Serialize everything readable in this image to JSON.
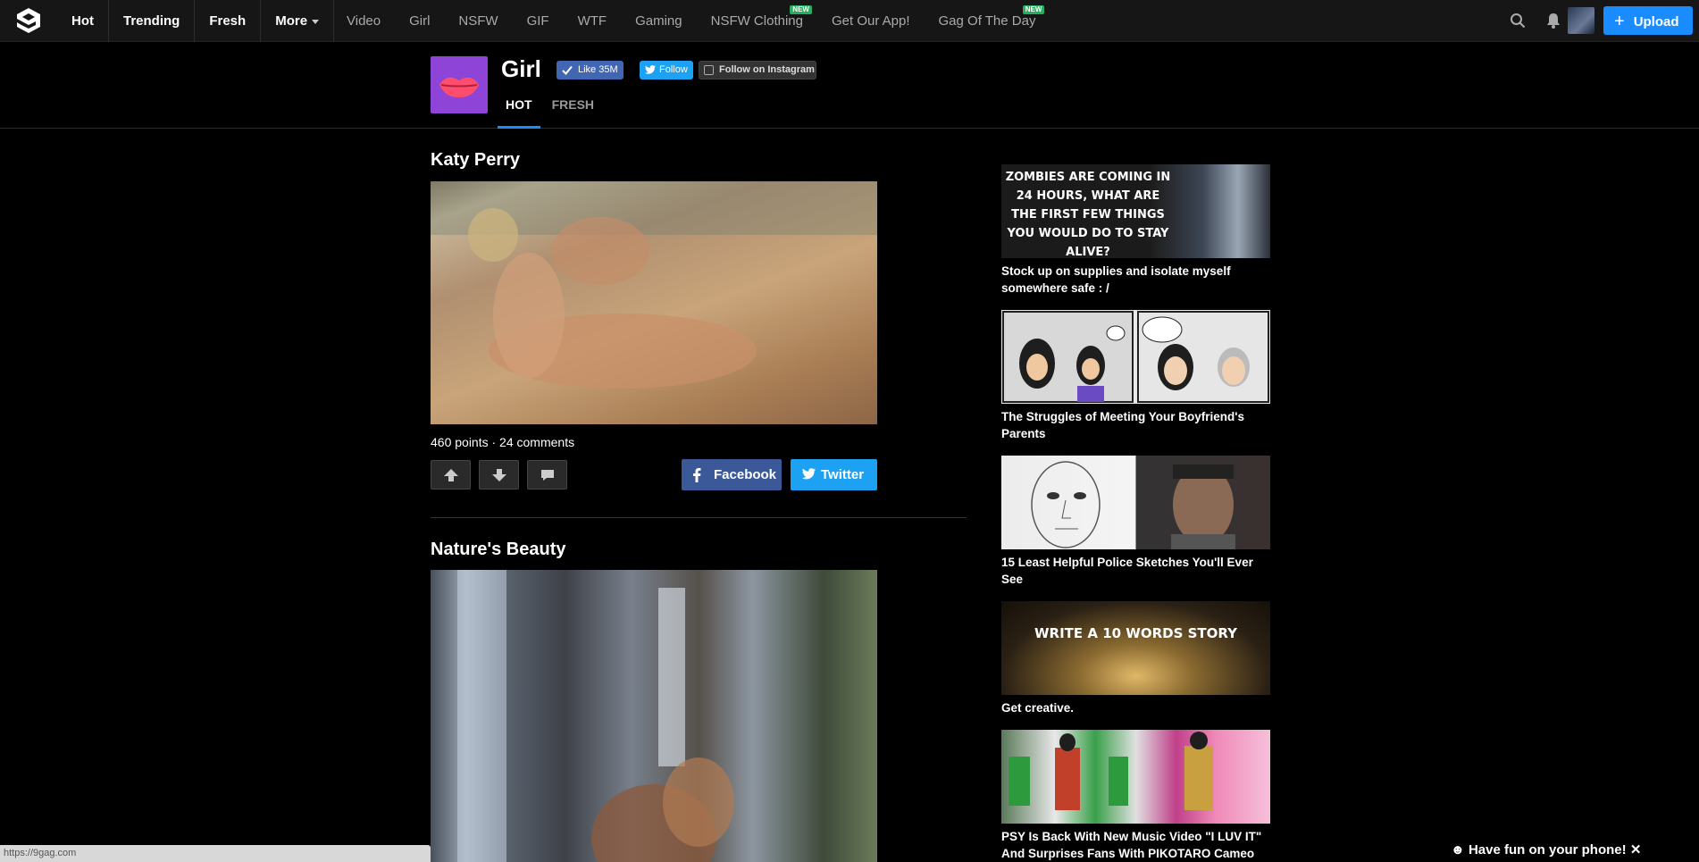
{
  "nav": {
    "main": [
      "Hot",
      "Trending",
      "Fresh",
      "More"
    ],
    "sections": [
      {
        "label": "Video",
        "new": false
      },
      {
        "label": "Girl",
        "new": false
      },
      {
        "label": "NSFW",
        "new": false
      },
      {
        "label": "GIF",
        "new": false
      },
      {
        "label": "WTF",
        "new": false
      },
      {
        "label": "Gaming",
        "new": false
      },
      {
        "label": "NSFW Clothing",
        "new": true
      },
      {
        "label": "Get Our App!",
        "new": false
      },
      {
        "label": "Gag Of The Day",
        "new": true
      }
    ],
    "new_badge": "NEW",
    "upload_label": "Upload"
  },
  "section": {
    "title": "Girl",
    "like_label": "Like 35M",
    "follow_label": "Follow",
    "instagram_label": "Follow on Instagram",
    "tabs": [
      "HOT",
      "FRESH"
    ],
    "icon_color": "#8e44d6"
  },
  "posts": [
    {
      "title": "Katy Perry",
      "meta": "460 points · 24 comments",
      "share_facebook": "Facebook",
      "share_twitter": "Twitter"
    },
    {
      "title": "Nature's Beauty"
    }
  ],
  "sidebar": [
    {
      "thumb_text": "ZOMBIES ARE COMING IN 24 HOURS, WHAT ARE THE FIRST FEW THINGS YOU WOULD DO TO STAY ALIVE?",
      "caption": "Stock up on supplies and isolate myself somewhere safe : /"
    },
    {
      "thumb_text": "",
      "caption": "The Struggles of Meeting Your Boyfriend's Parents"
    },
    {
      "thumb_text": "",
      "caption": "15 Least Helpful Police Sketches You'll Ever See"
    },
    {
      "thumb_text": "WRITE A 10 WORDS STORY",
      "caption": "Get creative."
    },
    {
      "thumb_text": "",
      "caption": "PSY Is Back With New Music Video \"I LUV IT\" And Surprises Fans With PIKOTARO Cameo"
    }
  ],
  "status_url": "https://9gag.com",
  "phone_banner": "Have fun on your phone!",
  "colors": {
    "accent": "#1a8cff",
    "facebook": "#3b5998",
    "twitter": "#1da1f2",
    "new_badge": "#27ae60"
  }
}
